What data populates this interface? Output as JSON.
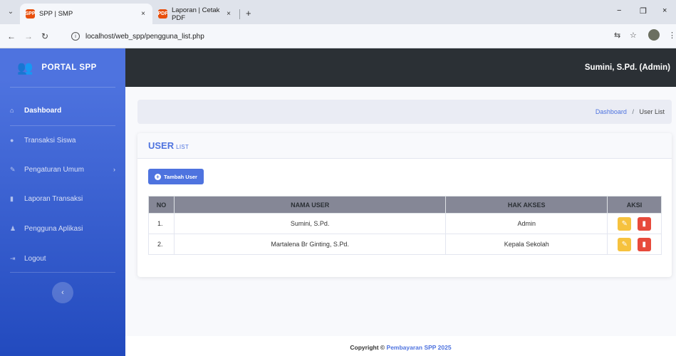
{
  "browser": {
    "tabs": [
      {
        "favicon": "SPP",
        "label": "SPP | SMP",
        "close": "×"
      },
      {
        "favicon": "PDF",
        "label": "Laporan | Cetak PDF",
        "close": "×"
      }
    ],
    "new_tab": "+",
    "url": "localhost/web_spp/pengguna_list.php",
    "controls": {
      "minimize": "−",
      "restore": "❐",
      "close": "×"
    }
  },
  "sidebar": {
    "brand": "PORTAL SPP",
    "items": [
      {
        "label": "Dashboard",
        "icon": "home-icon",
        "active": true
      },
      {
        "label": "Transaksi Siswa",
        "icon": "users-icon"
      },
      {
        "label": "Pengaturan Umum",
        "icon": "wrench-icon",
        "has_submenu": true
      },
      {
        "label": "Laporan Transaksi",
        "icon": "file-icon"
      },
      {
        "label": "Pengguna Aplikasi",
        "icon": "user-icon"
      },
      {
        "label": "Logout",
        "icon": "logout-icon"
      }
    ]
  },
  "topbar": {
    "user": "Sumini, S.Pd. (Admin)"
  },
  "breadcrumb": {
    "home": "Dashboard",
    "separator": "/",
    "current": "User List"
  },
  "card": {
    "title": "USER",
    "subtitle": "LIST",
    "add_button": "Tambah User"
  },
  "table": {
    "headers": [
      "NO",
      "NAMA USER",
      "HAK AKSES",
      "AKSI"
    ],
    "rows": [
      {
        "no": "1.",
        "name": "Sumini, S.Pd.",
        "role": "Admin"
      },
      {
        "no": "2.",
        "name": "Martalena Br Ginting, S.Pd.",
        "role": "Kepala Sekolah"
      }
    ]
  },
  "footer": {
    "prefix": "Copyright © ",
    "brand": "Pembayaran SPP 2025"
  },
  "colors": {
    "primary": "#4e73df",
    "warning": "#f6c23e",
    "danger": "#e74a3b",
    "topbar": "#2b3035"
  }
}
